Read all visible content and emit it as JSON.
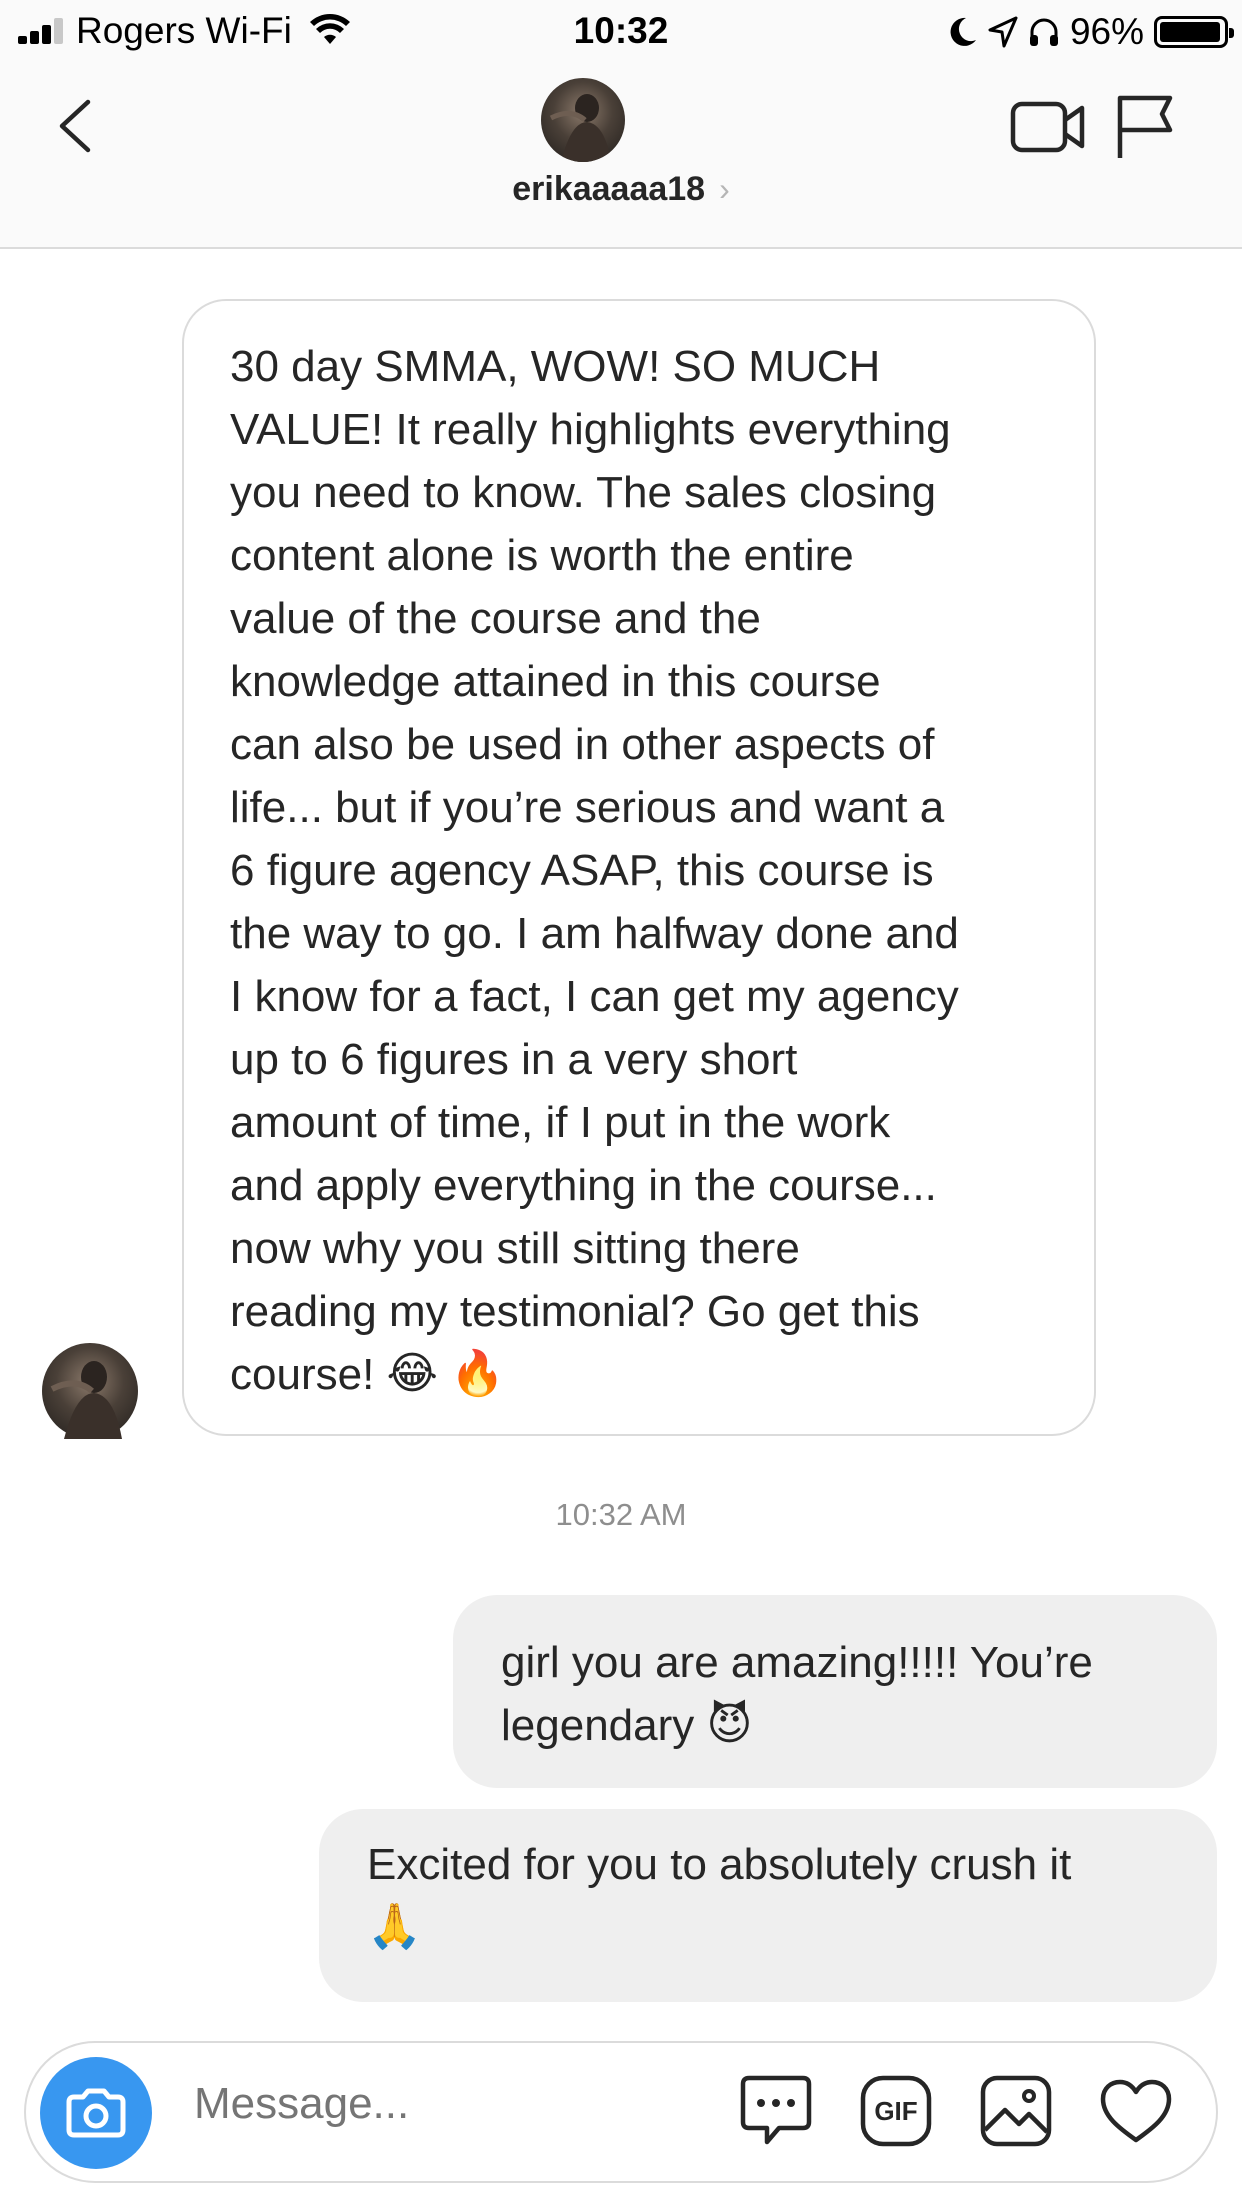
{
  "status_bar": {
    "carrier": "Rogers Wi-Fi",
    "time": "10:32",
    "battery": "96%",
    "battery_level": 0.96
  },
  "header": {
    "username": "erikaaaaa18",
    "chevron": "›"
  },
  "thread": {
    "incoming": {
      "text": "30 day SMMA, WOW! SO MUCH\nVALUE! It really highlights everything\nyou need to know. The sales closing\ncontent alone is worth the entire\nvalue of the course and the\nknowledge attained in this course\ncan also be used in other aspects of\nlife... but if you’re serious and want a\n6 figure agency ASAP, this course is\nthe way to go. I am halfway done and\nI know for a fact, I can get my agency\nup to 6 figures in a very short\namount of time, if I put in the work\nand apply everything in the course...\nnow why you still sitting there\nreading my testimonial? Go get this\ncourse!",
      "emojis": [
        "😂",
        "🔥"
      ]
    },
    "timestamp": "10:32 AM",
    "outgoing": [
      {
        "text": "girl you are amazing!!!!! You’re\nlegendary",
        "emoji": "😈"
      },
      {
        "text": "Excited for you to absolutely crush it\n",
        "emoji": "🙏"
      }
    ]
  },
  "composer": {
    "placeholder": "Message...",
    "gif_label": "GIF"
  },
  "icons": {
    "back": "chevron-left-icon",
    "video": "video-call-icon",
    "flag": "flag-icon",
    "camera": "camera-icon",
    "sticker": "chat-bubble-icon",
    "gallery": "image-icon",
    "like": "heart-icon"
  },
  "colors": {
    "accent": "#3897f0",
    "bubble_outgoing": "#efefef",
    "border": "#dbdbdb"
  }
}
